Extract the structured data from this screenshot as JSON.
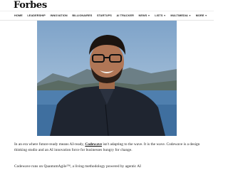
{
  "brand": {
    "logo_text": "Forbes"
  },
  "nav": {
    "items": [
      {
        "label": "HOME",
        "has_dropdown": false
      },
      {
        "label": "LEADERSHIP",
        "has_dropdown": false
      },
      {
        "label": "INNOVATION",
        "has_dropdown": false
      },
      {
        "label": "BILLIONAIRES",
        "has_dropdown": false
      },
      {
        "label": "STARTUPS",
        "has_dropdown": false
      },
      {
        "label": "AI TRACKER",
        "has_dropdown": false
      },
      {
        "label": "NEWS",
        "has_dropdown": true
      },
      {
        "label": "LISTS",
        "has_dropdown": true
      },
      {
        "label": "MULTIMEDIA",
        "has_dropdown": true
      },
      {
        "label": "MORE",
        "has_dropdown": true
      }
    ]
  },
  "article": {
    "p1_before": "In an era where future-ready means AI-ready, ",
    "p1_link": "Codewave",
    "p1_after": " isn't adapting to the wave. It is the wave. Codewave is a design thinking studio and an AI innovation force for businesses hungry for change.",
    "p2": "Codewave runs on QuantumAgile™, a living methodology powered by agentic AI"
  },
  "colors": {
    "sky": "#8fb0cf",
    "jacket": "#1f2530",
    "water": "#4f7fae"
  }
}
